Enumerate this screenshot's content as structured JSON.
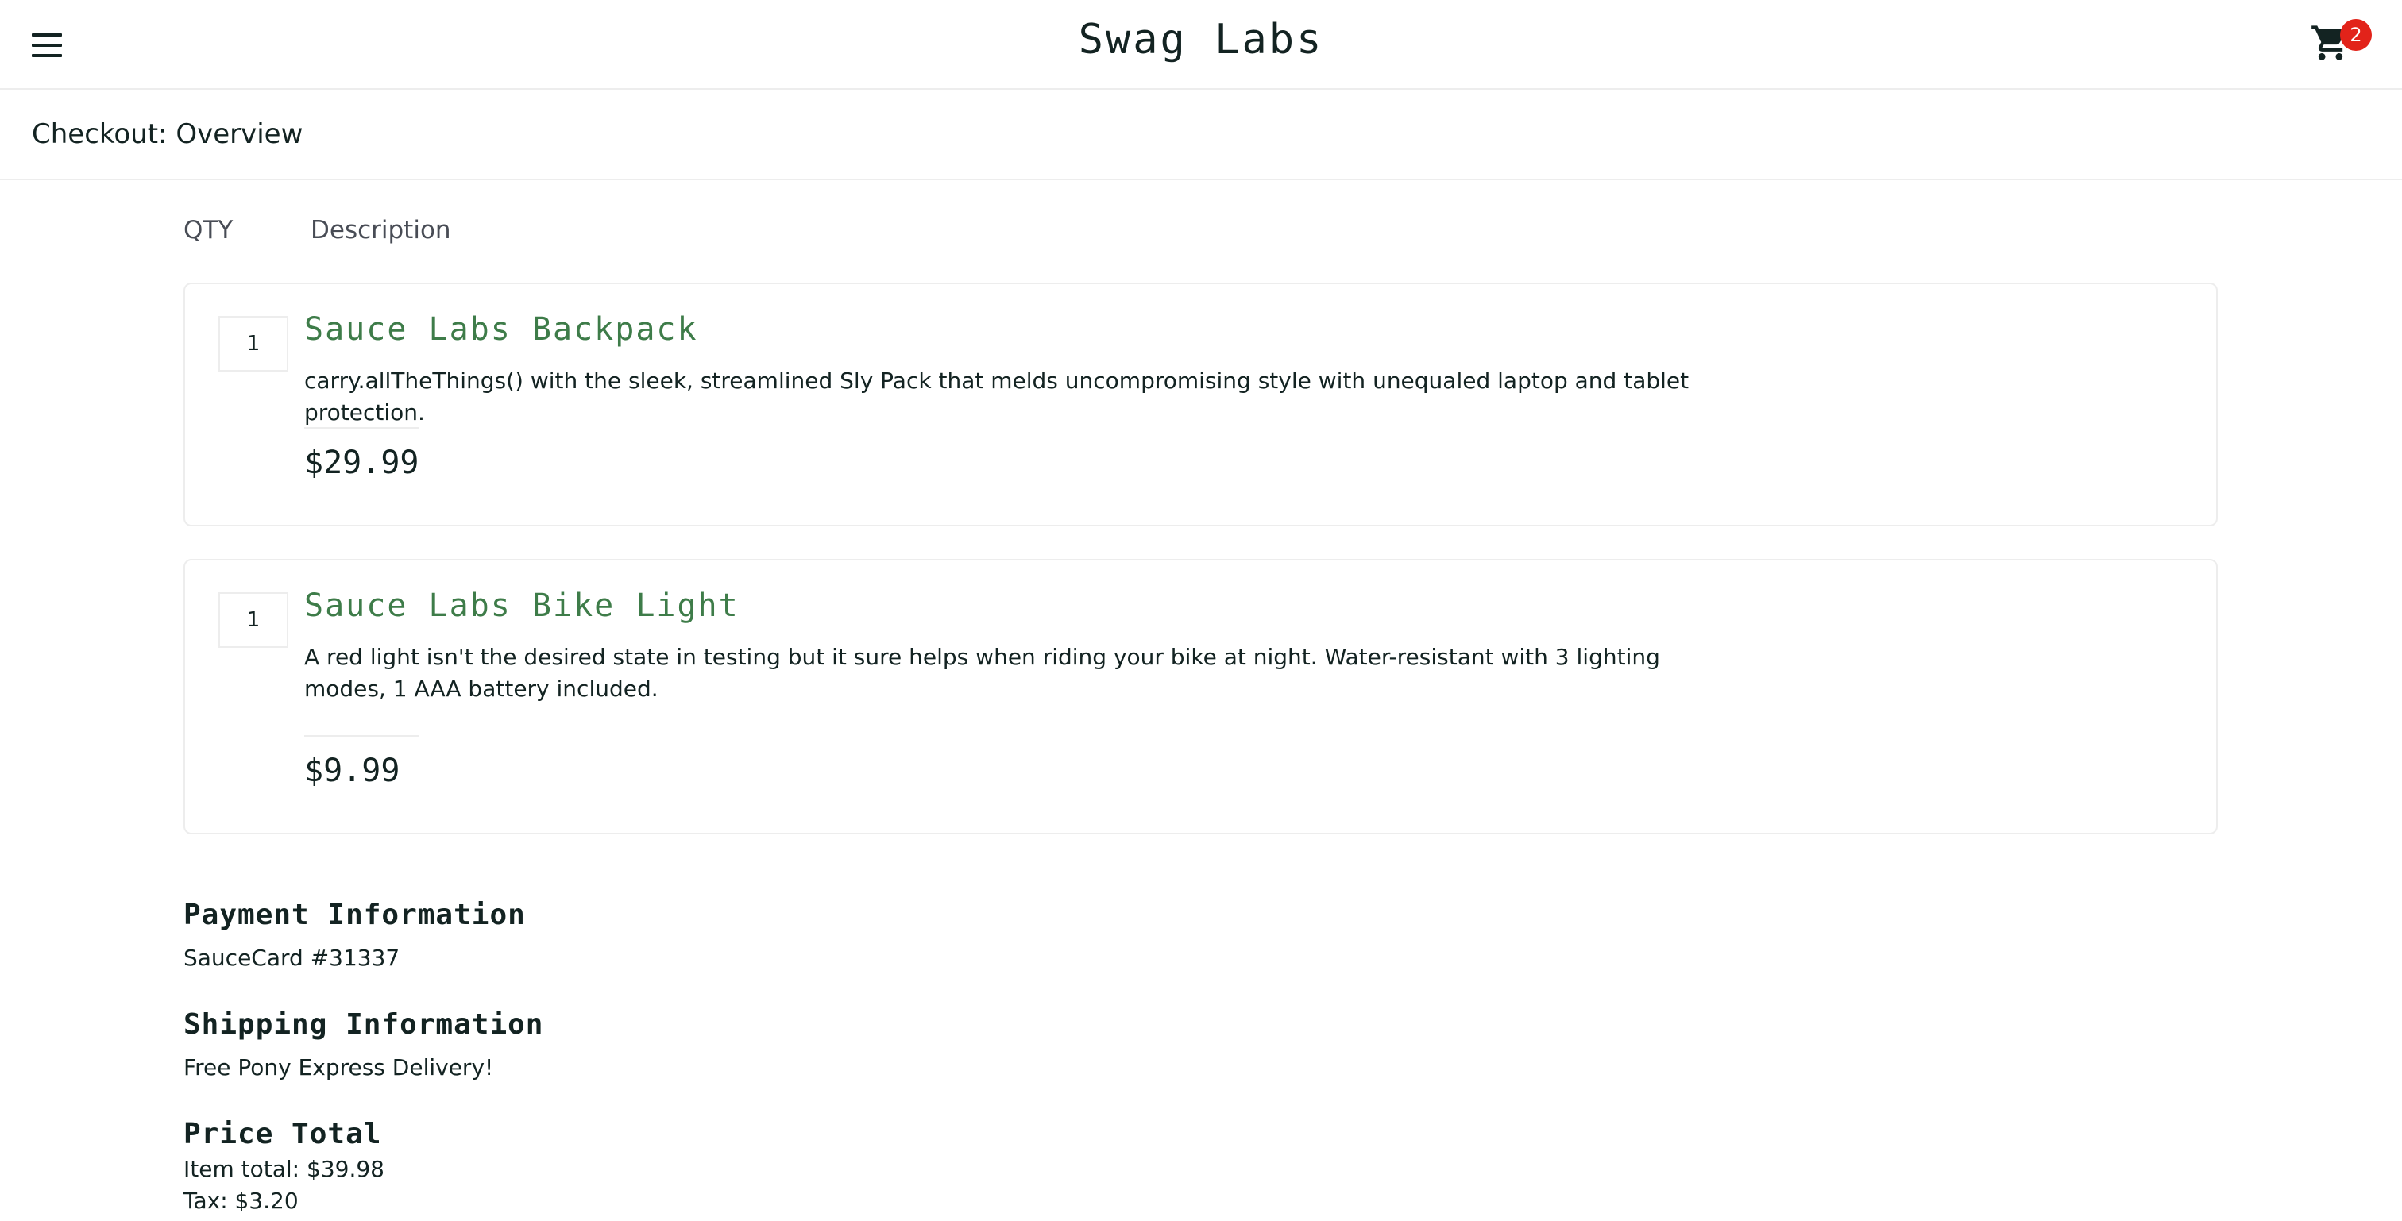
{
  "header": {
    "app_logo": "Swag Labs",
    "cart_count": "2",
    "menu_icon": "hamburger-menu-icon",
    "cart_icon": "shopping-cart-icon"
  },
  "page": {
    "title": "Checkout: Overview"
  },
  "cart_list": {
    "qty_label": "QTY",
    "desc_label": "Description",
    "items": [
      {
        "quantity": "1",
        "name": "Sauce Labs Backpack",
        "description": "carry.allTheThings() with the sleek, streamlined Sly Pack that melds uncompromising style with unequaled laptop and tablet protection.",
        "price": "$29.99"
      },
      {
        "quantity": "1",
        "name": "Sauce Labs Bike Light",
        "description": "A red light isn't the desired state in testing but it sure helps when riding your bike at night. Water-resistant with 3 lighting modes, 1 AAA battery included.",
        "price": "$9.99"
      }
    ]
  },
  "summary": {
    "payment_label": "Payment Information",
    "payment_value": "SauceCard #31337",
    "shipping_label": "Shipping Information",
    "shipping_value": "Free Pony Express Delivery!",
    "total_label": "Price Total",
    "item_total": "Item total: $39.98",
    "tax": "Tax: $3.20"
  },
  "colors": {
    "accent_green": "#3e7c49",
    "badge_red": "#e2231a",
    "border": "#ededed",
    "text": "#132322"
  }
}
